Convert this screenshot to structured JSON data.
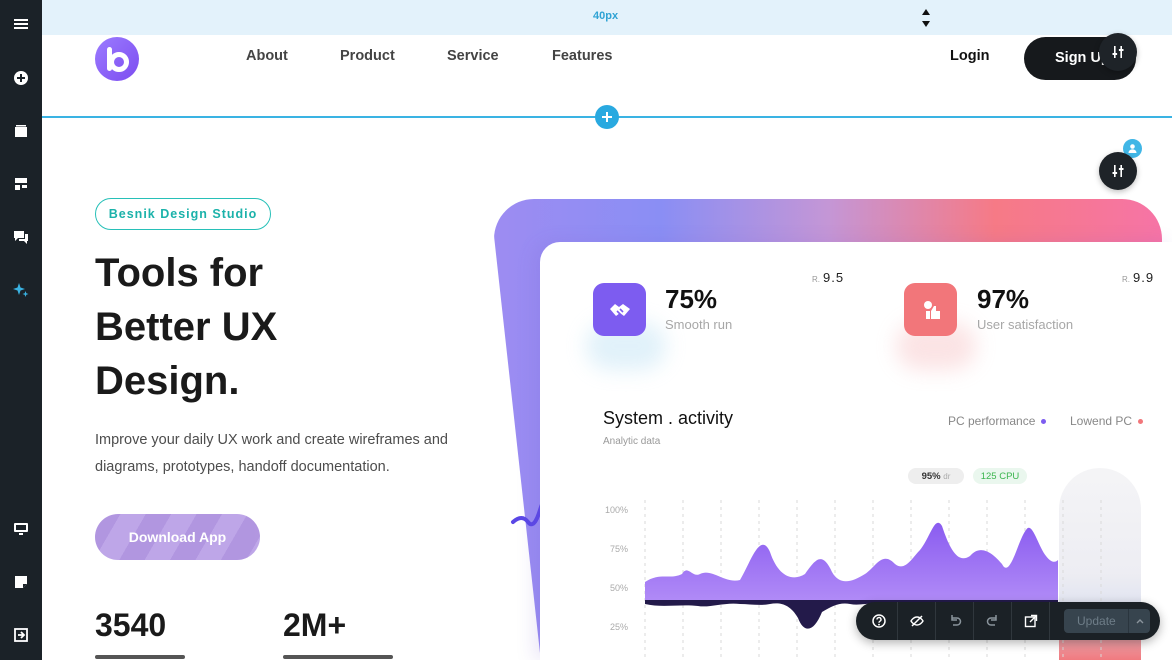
{
  "spacer": {
    "label": "40px"
  },
  "nav": {
    "links": [
      "About",
      "Product",
      "Service",
      "Features"
    ],
    "login": "Login",
    "signup": "Sign Up"
  },
  "hero": {
    "badge": "Besnik Design Studio",
    "headline": [
      "Tools for",
      "Better UX",
      "Design."
    ],
    "description": "Improve your daily UX work and create wireframes and diagrams, prototypes, handoff documentation.",
    "download_label": "Download App",
    "stats": [
      "3540",
      "2M+"
    ]
  },
  "dashboard": {
    "metrics": [
      {
        "value": "75%",
        "label": "Smooth run",
        "rating_prefix": "R.",
        "rating": "9.5",
        "color": "#7d5cf0"
      },
      {
        "value": "97%",
        "label": "User satisfaction",
        "rating_prefix": "R.",
        "rating": "9.9",
        "color": "#f2767a"
      }
    ],
    "title": "System . activity",
    "subtitle": "Analytic data",
    "legend": [
      {
        "name": "PC performance",
        "color": "#7d5cf0"
      },
      {
        "name": "Lowend PC",
        "color": "#f2767a"
      }
    ],
    "chips": [
      {
        "main": "95%",
        "sub": "dr"
      },
      {
        "main": "125 CPU"
      }
    ],
    "y_ticks": [
      "100%",
      "75%",
      "50%",
      "25%"
    ]
  },
  "toolbar": {
    "icons": [
      "help-icon",
      "hide-icon",
      "undo-icon",
      "redo-icon",
      "open-external-icon"
    ],
    "update_label": "Update"
  },
  "colors": {
    "sidebar": "#1b2228",
    "accent_blue": "#29a9e0",
    "teal": "#27c0b8",
    "purple": "#7d5cf0",
    "coral": "#f2767a"
  }
}
